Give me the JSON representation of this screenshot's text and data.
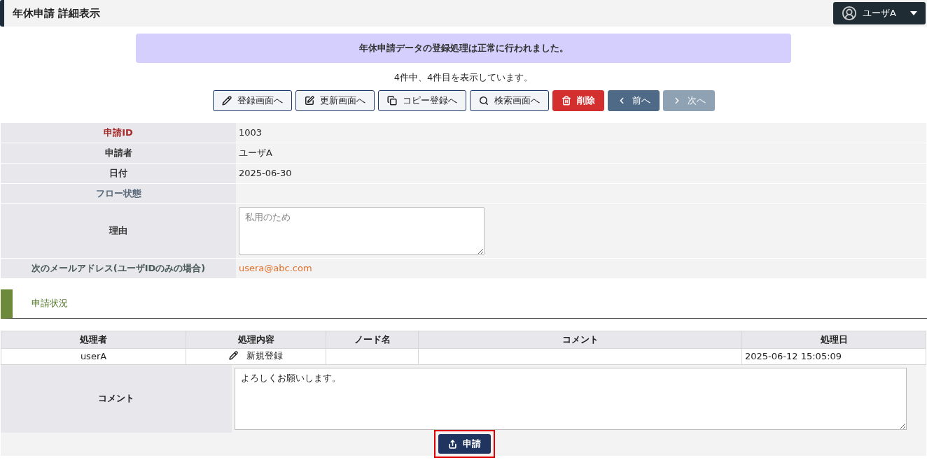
{
  "header": {
    "title": "年休申請 詳細表示",
    "user_menu": {
      "label": "ユーザA"
    }
  },
  "message": "年休申請データの登録処理は正常に行われました。",
  "record_count": "4件中、4件目を表示しています。",
  "toolbar": [
    {
      "label": "登録画面へ",
      "kind": "outline",
      "disabled": false
    },
    {
      "label": "更新画面へ",
      "kind": "outline",
      "disabled": false
    },
    {
      "label": "コピー登録へ",
      "kind": "outline",
      "disabled": false
    },
    {
      "label": "検索画面へ",
      "kind": "outline",
      "disabled": false
    },
    {
      "label": "削除",
      "kind": "danger",
      "disabled": false
    },
    {
      "label": "前へ",
      "kind": "nav",
      "disabled": false
    },
    {
      "label": "次へ",
      "kind": "nav",
      "disabled": true
    }
  ],
  "fields": [
    {
      "label": "申請ID",
      "color": "#a52a2a",
      "kind": "text",
      "value": "1003"
    },
    {
      "label": "申請者",
      "color": "#333333",
      "kind": "text",
      "value": "ユーザA"
    },
    {
      "label": "日付",
      "color": "#333333",
      "kind": "text",
      "value": "2025-06-30"
    },
    {
      "label": "フロー状態",
      "color": "#5a6a7a",
      "kind": "empty"
    },
    {
      "label": "理由",
      "color": "#333333",
      "kind": "textarea",
      "placeholder": "私用のため"
    },
    {
      "label": "次のメールアドレス(ユーザIDのみの場合)",
      "color": "#4a5a5a",
      "kind": "email",
      "value": "usera@abc.com"
    }
  ],
  "section": {
    "title": "申請状況"
  },
  "history": {
    "columns": [
      "処理者",
      "処理内容",
      "ノード名",
      "コメント",
      "処理日"
    ],
    "rows": [
      {
        "cells": [
          "userA",
          "新規登録",
          "",
          "",
          "2025-06-12 15:05:09"
        ]
      }
    ]
  },
  "comment": {
    "label": "コメント",
    "value": "よろしくお願いします。"
  },
  "submit": {
    "label": "申請",
    "highlighted": true
  }
}
